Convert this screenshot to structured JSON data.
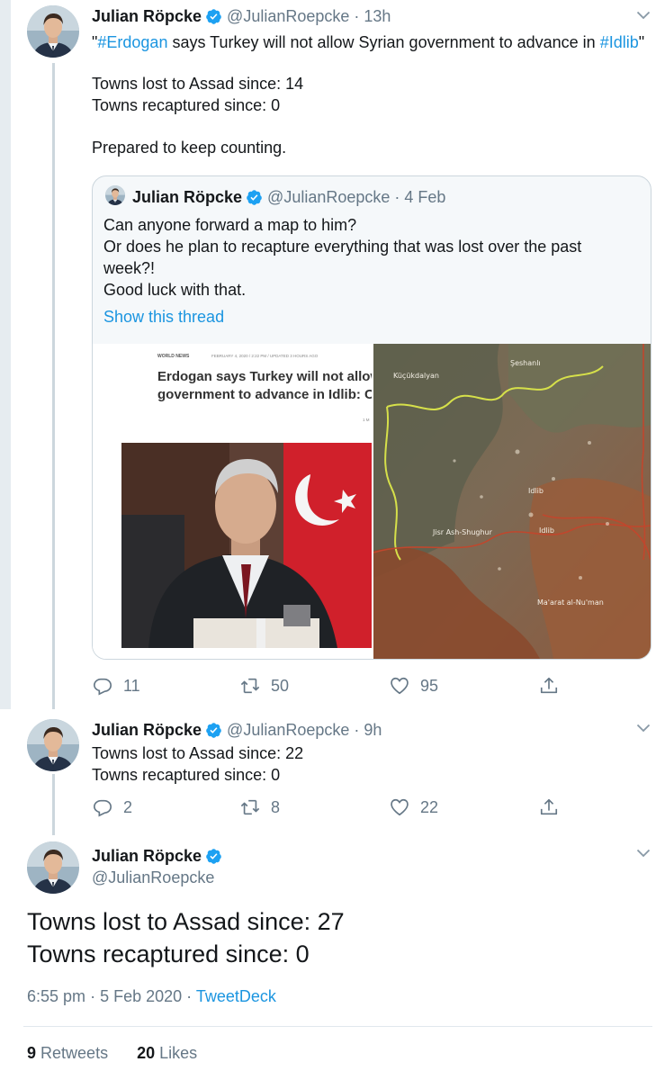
{
  "tweet1": {
    "name": "Julian Röpcke",
    "handle": "@JulianRoepcke",
    "time": "13h",
    "line1_pre": "\"",
    "hashtag1": "#Erdogan",
    "line1_mid": " says Turkey will not allow Syrian government to advance in ",
    "hashtag2": "#Idlib",
    "line1_post": "\"",
    "line2": "Towns lost to Assad since: 14",
    "line3": "Towns recaptured since: 0",
    "line4": "Prepared to keep counting.",
    "quote": {
      "name": "Julian Röpcke",
      "handle": "@JulianRoepcke",
      "time": "4 Feb",
      "line1": "Can anyone forward a map to him?",
      "line2": "Or does he plan to recapture everything that was lost over the past week?!",
      "line3": "Good luck with that.",
      "show_thread": "Show this thread",
      "article": {
        "section": "WORLD NEWS",
        "dateline": "FEBRUARY 4, 2020 / 2:22 PM / UPDATED 3 HOURS AGO",
        "headline1": "Erdogan says Turkey will not allow",
        "headline2": "government to advance in Idlib: CN",
        "byline": "1 M"
      },
      "map_labels": {
        "a": "Küçükdalyan",
        "b": "Şeshanlı",
        "c": "Idlib",
        "d": "Jisr Ash-Shughur",
        "e": "Idlib",
        "f": "Ma'arat al-Nu'man"
      }
    },
    "replies": "11",
    "retweets": "50",
    "likes": "95"
  },
  "tweet2": {
    "name": "Julian Röpcke",
    "handle": "@JulianRoepcke",
    "time": "9h",
    "line1": "Towns lost to Assad since: 22",
    "line2": "Towns recaptured since: 0",
    "replies": "2",
    "retweets": "8",
    "likes": "22"
  },
  "tweet3": {
    "name": "Julian Röpcke",
    "handle": "@JulianRoepcke",
    "line1": "Towns lost to Assad since: 27",
    "line2": "Towns recaptured since: 0",
    "time": "6:55 pm",
    "date": "5 Feb 2020",
    "source": "TweetDeck",
    "retweet_count": "9",
    "retweet_label": "Retweets",
    "like_count": "20",
    "like_label": "Likes"
  },
  "colors": {
    "link": "#1b95e0",
    "muted": "#657786",
    "verified": "#1da1f2",
    "thread_line": "#ccd6dd"
  },
  "icons": {
    "verified": "verified-badge-icon",
    "reply": "reply-icon",
    "retweet": "retweet-icon",
    "like": "heart-icon",
    "share": "share-icon",
    "menu": "chevron-down-icon"
  }
}
